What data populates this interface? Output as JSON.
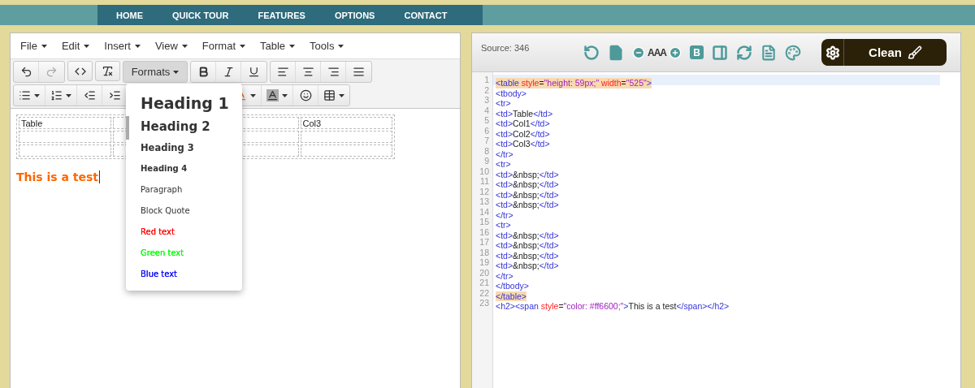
{
  "nav": {
    "items": [
      "HOME",
      "QUICK TOUR",
      "FEATURES",
      "OPTIONS",
      "CONTACT"
    ]
  },
  "editor": {
    "menu": [
      "File",
      "Edit",
      "Insert",
      "View",
      "Format",
      "Table",
      "Tools"
    ],
    "toolbar": {
      "undo": {
        "disabled": false
      },
      "redo": {
        "disabled": true
      },
      "formats": {
        "label": "Formats",
        "open": true
      }
    },
    "formats_menu": [
      {
        "kind": "h1",
        "label": "Heading 1"
      },
      {
        "kind": "h2",
        "label": "Heading 2"
      },
      {
        "kind": "h3",
        "label": "Heading 3"
      },
      {
        "kind": "h4",
        "label": "Heading 4"
      },
      {
        "kind": "plain",
        "label": "Paragraph"
      },
      {
        "kind": "plain",
        "label": "Block Quote"
      },
      {
        "kind": "colored",
        "label": "Red text",
        "color": "#ff0000"
      },
      {
        "kind": "colored",
        "label": "Green text",
        "color": "#00ff00"
      },
      {
        "kind": "colored",
        "label": "Blue text",
        "color": "#0000ff"
      }
    ],
    "table": {
      "rows": [
        [
          "Table",
          null,
          null,
          "Col3"
        ],
        [
          null,
          null,
          null,
          null
        ],
        [
          null,
          null,
          null,
          null
        ]
      ]
    },
    "heading": "This is a test"
  },
  "source": {
    "count_label": "Source: 346",
    "font_size_label": "AAA",
    "bold_label": "B",
    "clean_label": "Clean",
    "lines": [
      {
        "number": "1",
        "active": true,
        "matched": true,
        "tokens": [
          {
            "kind": "tag",
            "text": "<table"
          },
          {
            "kind": "attr",
            "text": " style"
          },
          {
            "kind": "punct",
            "text": "="
          },
          {
            "kind": "value",
            "text": "\"height: 59px;\""
          },
          {
            "kind": "attr",
            "text": " width"
          },
          {
            "kind": "punct",
            "text": "="
          },
          {
            "kind": "value",
            "text": "\"525\""
          },
          {
            "kind": "tag",
            "text": ">"
          }
        ]
      },
      {
        "number": "2",
        "active": false,
        "matched": false,
        "tokens": [
          {
            "kind": "tag",
            "text": "<tbody>"
          }
        ]
      },
      {
        "number": "3",
        "active": false,
        "matched": false,
        "tokens": [
          {
            "kind": "tag",
            "text": "<tr>"
          }
        ]
      },
      {
        "number": "4",
        "active": false,
        "matched": false,
        "tokens": [
          {
            "kind": "tag",
            "text": "<td>"
          },
          {
            "kind": "text",
            "text": "Table"
          },
          {
            "kind": "tag",
            "text": "</td>"
          }
        ]
      },
      {
        "number": "5",
        "active": false,
        "matched": false,
        "tokens": [
          {
            "kind": "tag",
            "text": "<td>"
          },
          {
            "kind": "text",
            "text": "Col1"
          },
          {
            "kind": "tag",
            "text": "</td>"
          }
        ]
      },
      {
        "number": "6",
        "active": false,
        "matched": false,
        "tokens": [
          {
            "kind": "tag",
            "text": "<td>"
          },
          {
            "kind": "text",
            "text": "Col2"
          },
          {
            "kind": "tag",
            "text": "</td>"
          }
        ]
      },
      {
        "number": "7",
        "active": false,
        "matched": false,
        "tokens": [
          {
            "kind": "tag",
            "text": "<td>"
          },
          {
            "kind": "text",
            "text": "Col3"
          },
          {
            "kind": "tag",
            "text": "</td>"
          }
        ]
      },
      {
        "number": "8",
        "active": false,
        "matched": false,
        "tokens": [
          {
            "kind": "tag",
            "text": "</tr>"
          }
        ]
      },
      {
        "number": "9",
        "active": false,
        "matched": false,
        "tokens": [
          {
            "kind": "tag",
            "text": "<tr>"
          }
        ]
      },
      {
        "number": "10",
        "active": false,
        "matched": false,
        "tokens": [
          {
            "kind": "tag",
            "text": "<td>"
          },
          {
            "kind": "text",
            "text": "&nbsp;"
          },
          {
            "kind": "tag",
            "text": "</td>"
          }
        ]
      },
      {
        "number": "11",
        "active": false,
        "matched": false,
        "tokens": [
          {
            "kind": "tag",
            "text": "<td>"
          },
          {
            "kind": "text",
            "text": "&nbsp;"
          },
          {
            "kind": "tag",
            "text": "</td>"
          }
        ]
      },
      {
        "number": "12",
        "active": false,
        "matched": false,
        "tokens": [
          {
            "kind": "tag",
            "text": "<td>"
          },
          {
            "kind": "text",
            "text": "&nbsp;"
          },
          {
            "kind": "tag",
            "text": "</td>"
          }
        ]
      },
      {
        "number": "13",
        "active": false,
        "matched": false,
        "tokens": [
          {
            "kind": "tag",
            "text": "<td>"
          },
          {
            "kind": "text",
            "text": "&nbsp;"
          },
          {
            "kind": "tag",
            "text": "</td>"
          }
        ]
      },
      {
        "number": "14",
        "active": false,
        "matched": false,
        "tokens": [
          {
            "kind": "tag",
            "text": "</tr>"
          }
        ]
      },
      {
        "number": "15",
        "active": false,
        "matched": false,
        "tokens": [
          {
            "kind": "tag",
            "text": "<tr>"
          }
        ]
      },
      {
        "number": "16",
        "active": false,
        "matched": false,
        "tokens": [
          {
            "kind": "tag",
            "text": "<td>"
          },
          {
            "kind": "text",
            "text": "&nbsp;"
          },
          {
            "kind": "tag",
            "text": "</td>"
          }
        ]
      },
      {
        "number": "17",
        "active": false,
        "matched": false,
        "tokens": [
          {
            "kind": "tag",
            "text": "<td>"
          },
          {
            "kind": "text",
            "text": "&nbsp;"
          },
          {
            "kind": "tag",
            "text": "</td>"
          }
        ]
      },
      {
        "number": "18",
        "active": false,
        "matched": false,
        "tokens": [
          {
            "kind": "tag",
            "text": "<td>"
          },
          {
            "kind": "text",
            "text": "&nbsp;"
          },
          {
            "kind": "tag",
            "text": "</td>"
          }
        ]
      },
      {
        "number": "19",
        "active": false,
        "matched": false,
        "tokens": [
          {
            "kind": "tag",
            "text": "<td>"
          },
          {
            "kind": "text",
            "text": "&nbsp;"
          },
          {
            "kind": "tag",
            "text": "</td>"
          }
        ]
      },
      {
        "number": "20",
        "active": false,
        "matched": false,
        "tokens": [
          {
            "kind": "tag",
            "text": "</tr>"
          }
        ]
      },
      {
        "number": "21",
        "active": false,
        "matched": false,
        "tokens": [
          {
            "kind": "tag",
            "text": "</tbody>"
          }
        ]
      },
      {
        "number": "22",
        "active": false,
        "matched": true,
        "tokens": [
          {
            "kind": "tag",
            "text": "</table>"
          }
        ]
      },
      {
        "number": "23",
        "active": false,
        "matched": false,
        "tokens": [
          {
            "kind": "tag",
            "text": "<h2>"
          },
          {
            "kind": "tag",
            "text": "<span"
          },
          {
            "kind": "attr",
            "text": " style"
          },
          {
            "kind": "punct",
            "text": "="
          },
          {
            "kind": "value",
            "text": "\"color: #ff6600;\""
          },
          {
            "kind": "tag",
            "text": ">"
          },
          {
            "kind": "text",
            "text": "This is a test"
          },
          {
            "kind": "tag",
            "text": "</span>"
          },
          {
            "kind": "tag",
            "text": "</h2>"
          }
        ]
      }
    ]
  }
}
